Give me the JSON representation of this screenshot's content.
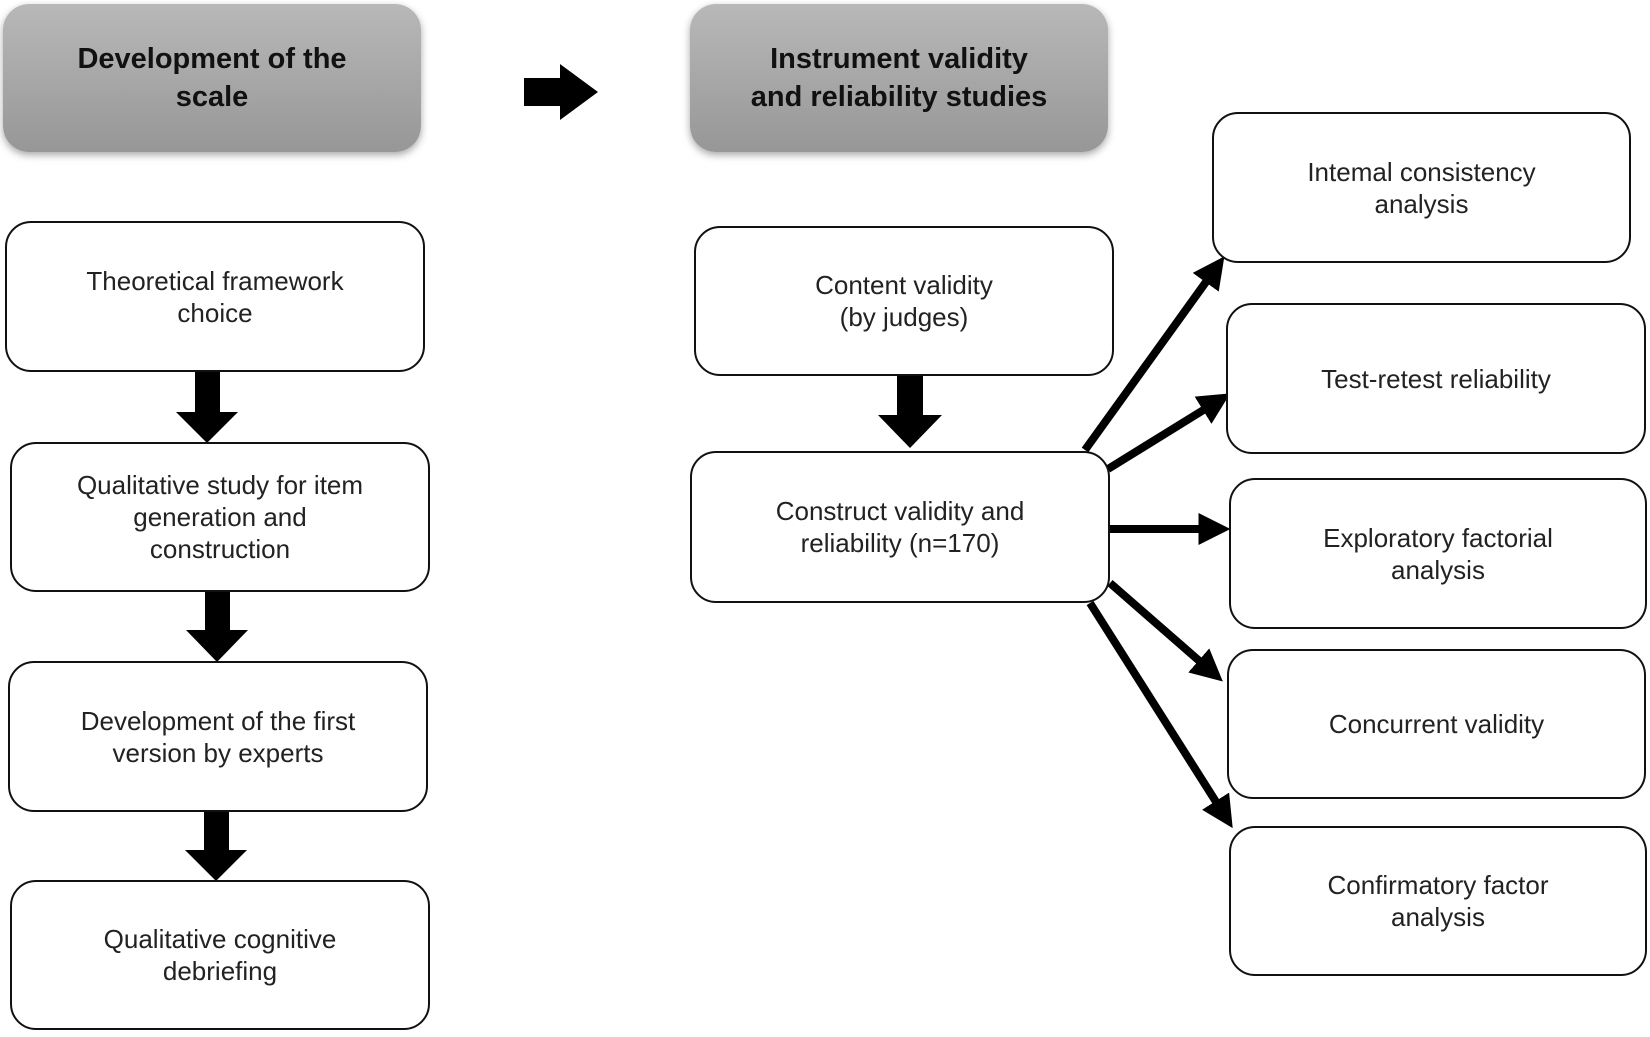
{
  "headers": {
    "left": "Development of the\nscale",
    "right": "Instrument validity\nand reliability studies"
  },
  "left_steps": [
    "Theoretical framework\nchoice",
    "Qualitative study for item\ngeneration and\nconstruction",
    "Development of the first\nversion by experts",
    "Qualitative cognitive\ndebriefing"
  ],
  "middle_steps": [
    "Content validity\n(by judges)",
    "Construct validity and\nreliability (n=170)"
  ],
  "analyses": [
    "Intemal consistency\nanalysis",
    "Test-retest reliability",
    "Exploratory factorial\nanalysis",
    "Concurrent validity",
    "Confirmatory factor\nanalysis"
  ]
}
